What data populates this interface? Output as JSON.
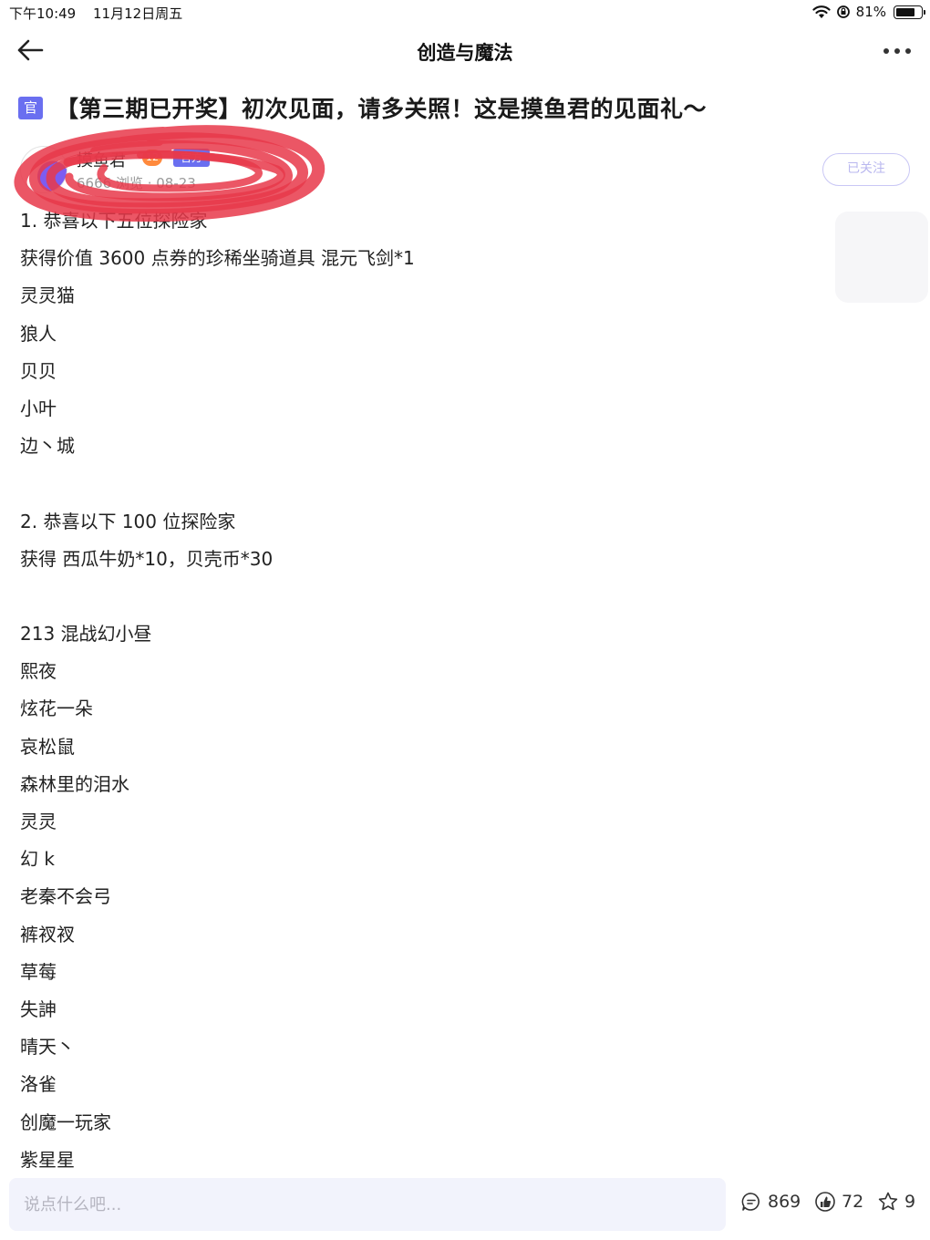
{
  "status_bar": {
    "time": "下午10:49",
    "date": "11月12日周五",
    "battery_text": "81%",
    "battery_level": 0.81
  },
  "nav": {
    "title": "创造与魔法",
    "back_icon": "back-arrow-icon",
    "more_icon": "more-dots-icon"
  },
  "post": {
    "official_tag": "官",
    "title": "【第三期已开奖】初次见面，请多关照！这是摸鱼君的见面礼～",
    "author": {
      "name": "摸鱼君",
      "level": "12",
      "role": "官方",
      "meta": "6666 浏览 · 08-23"
    },
    "follow_label": "已关注",
    "lines": [
      "1. 恭喜以下五位探险家",
      "获得价值 3600 点券的珍稀坐骑道具 混元飞剑*1",
      "灵灵猫",
      "狼人",
      "贝贝",
      "小叶",
      "边丶城",
      "",
      "2. 恭喜以下 100 位探险家",
      "获得 西瓜牛奶*10，贝壳币*30",
      "",
      "213 混战幻小昼",
      "熙夜",
      "炫花一朵",
      "哀松鼠",
      "森林里的泪水",
      "灵灵",
      "幻 k",
      "老秦不会弓",
      "裤衩衩",
      "草莓",
      "失訷",
      "晴天丶",
      "洛雀",
      "创魔一玩家",
      "紫星星"
    ]
  },
  "bottom": {
    "comment_placeholder": "说点什么吧...",
    "comments": "869",
    "likes": "72",
    "favorites": "9"
  },
  "colors": {
    "accent": "#6a6ff0",
    "scribble": "#e8384a"
  }
}
